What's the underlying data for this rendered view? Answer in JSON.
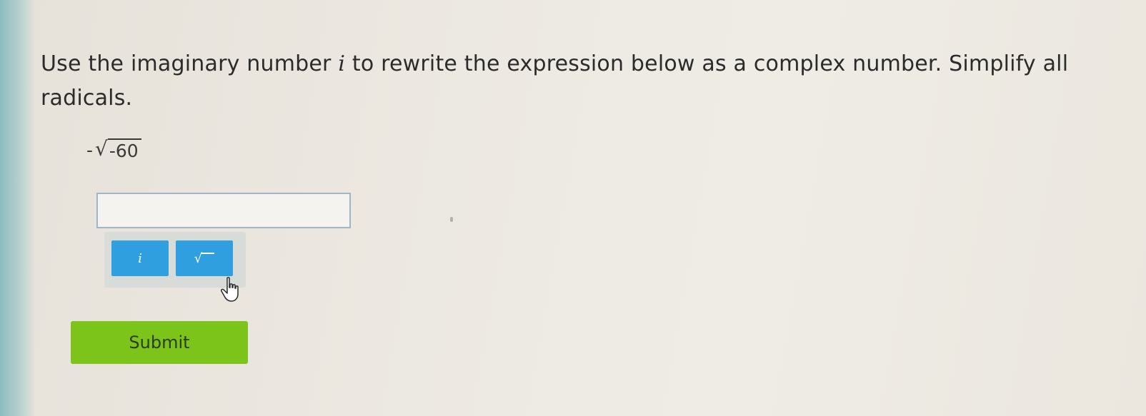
{
  "question": {
    "text_before": "Use the imaginary number ",
    "variable": "i",
    "text_after": " to rewrite the expression below as a complex number. Simplify all radicals."
  },
  "expression": {
    "sign": "-",
    "radicand": "-60"
  },
  "answer_input": {
    "value": "",
    "placeholder": ""
  },
  "keypad": {
    "i_key_label": "i",
    "sqrt_key_label": "√"
  },
  "submit": {
    "label": "Submit"
  },
  "colors": {
    "key_blue": "#2f9fe0",
    "submit_green": "#7cc41a",
    "left_rail_teal": "#8cbcbf"
  },
  "icons": {
    "cursor": "hand-pointer-icon",
    "sqrt": "square-root-icon"
  }
}
